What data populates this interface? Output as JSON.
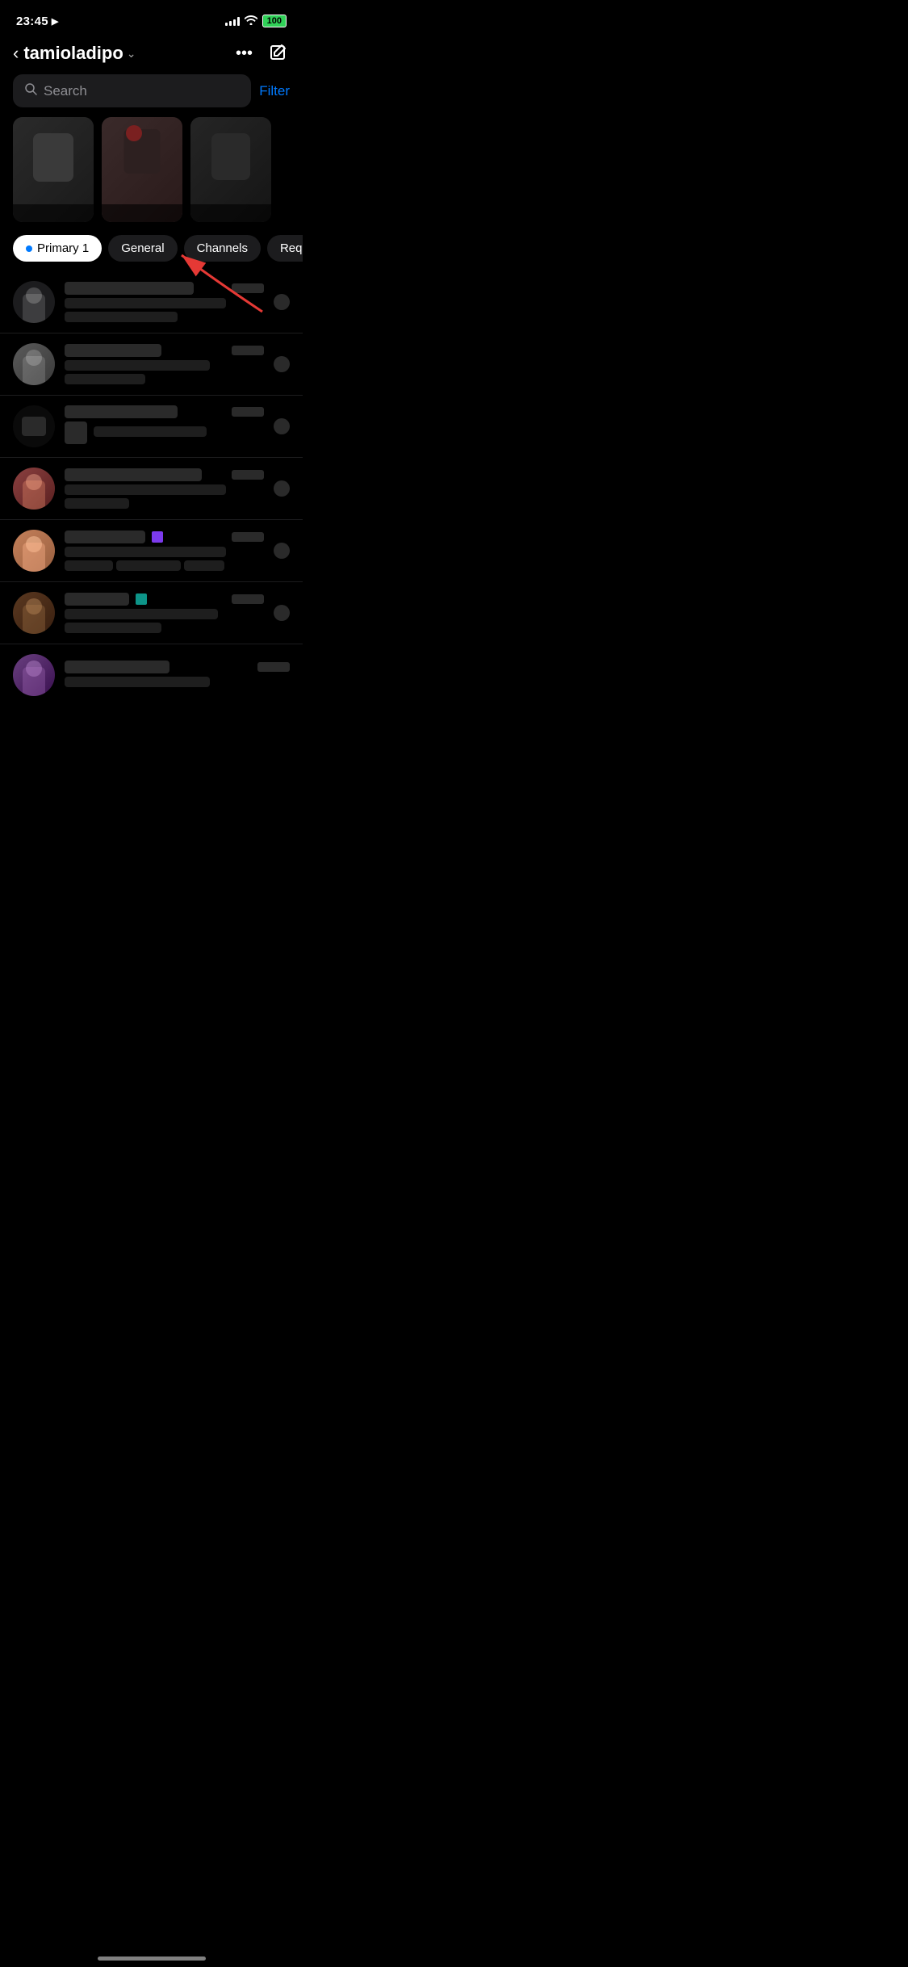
{
  "statusBar": {
    "time": "23:45",
    "battery": "100"
  },
  "header": {
    "backLabel": "‹",
    "title": "tamioladipo",
    "moreLabel": "•••",
    "composeLabel": "✎"
  },
  "search": {
    "placeholder": "Search",
    "filterLabel": "Filter"
  },
  "tabs": [
    {
      "id": "primary",
      "label": "Primary 1",
      "active": true
    },
    {
      "id": "general",
      "label": "General",
      "active": false
    },
    {
      "id": "channels",
      "label": "Channels",
      "active": false
    },
    {
      "id": "requests",
      "label": "Requests",
      "active": false
    }
  ],
  "chatItems": [
    {
      "id": 1,
      "avatarType": "dark",
      "hasContent": true
    },
    {
      "id": 2,
      "avatarType": "gray",
      "hasContent": true
    },
    {
      "id": 3,
      "avatarType": "dark2",
      "hasContent": true
    },
    {
      "id": 4,
      "avatarType": "redBrown",
      "hasContent": true
    },
    {
      "id": 5,
      "avatarType": "warm",
      "hasContent": true,
      "hasPurple": true
    },
    {
      "id": 6,
      "avatarType": "dark3",
      "hasContent": true,
      "hasTeal": true
    }
  ],
  "arrowColor": "#e53935"
}
